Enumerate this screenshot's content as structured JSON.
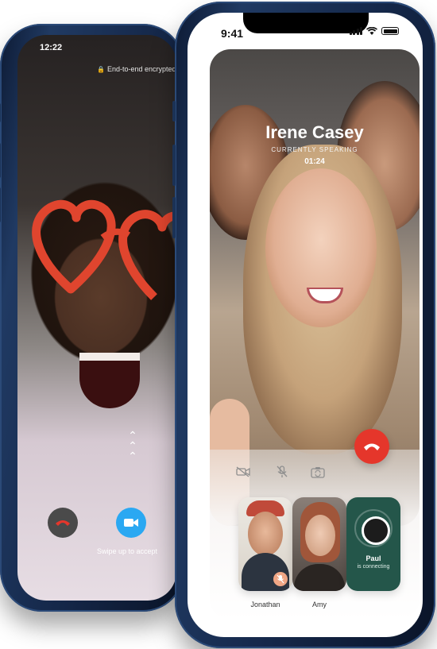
{
  "back_phone": {
    "status_time": "12:22",
    "encryption_note": "End-to-end encrypted",
    "swipe_hint": "Swipe up to accept",
    "icons": {
      "lock": "lock-icon",
      "decline": "phone-hangup-icon",
      "accept": "video-camera-icon",
      "swipe": "chevron-up-icon"
    },
    "colors": {
      "accept": "#2aa8f2",
      "decline_bg": "#4a4a4a",
      "decline_icon": "#e5362b",
      "glasses": "#e0452e"
    }
  },
  "front_phone": {
    "status_time": "9:41",
    "caller_name": "Irene Casey",
    "caller_status": "CURRENTLY SPEAKING",
    "call_timer": "01:24",
    "controls": [
      {
        "name": "camera-off-icon"
      },
      {
        "name": "microphone-off-icon"
      },
      {
        "name": "switch-camera-icon"
      }
    ],
    "hangup_color": "#e5362b",
    "participants": [
      {
        "name": "Jonathan",
        "muted": true
      },
      {
        "name": "Amy",
        "muted": false
      },
      {
        "name": "Paul",
        "status": "is connecting"
      }
    ]
  }
}
